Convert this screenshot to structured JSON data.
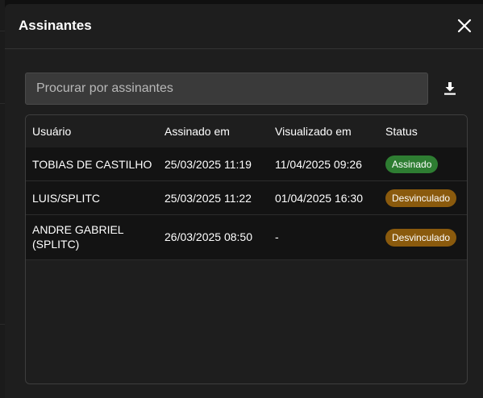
{
  "dialog": {
    "title": "Assinantes",
    "close_icon": "close-icon"
  },
  "search": {
    "placeholder": "Procurar por assinantes",
    "value": "",
    "download_icon": "download-icon"
  },
  "table": {
    "columns": [
      "Usuário",
      "Assinado em",
      "Visualizado em",
      "Status"
    ],
    "rows": [
      {
        "usuario": "TOBIAS DE CASTILHO",
        "assinado_em": "25/03/2025 11:19",
        "visualizado_em": "11/04/2025 09:26",
        "status": "Assinado"
      },
      {
        "usuario": "LUIS/SPLITC",
        "assinado_em": "25/03/2025 11:22",
        "visualizado_em": "01/04/2025 16:30",
        "status": "Desvinculado"
      },
      {
        "usuario_line1": "ANDRE GABRIEL",
        "usuario_line2": "(SPLITC)",
        "assinado_em": "26/03/2025 08:50",
        "visualizado_em": "-",
        "status": "Desvinculado"
      }
    ]
  },
  "colors": {
    "assinado": "#2e7d32",
    "desvinculado": "#8a5a0d"
  }
}
